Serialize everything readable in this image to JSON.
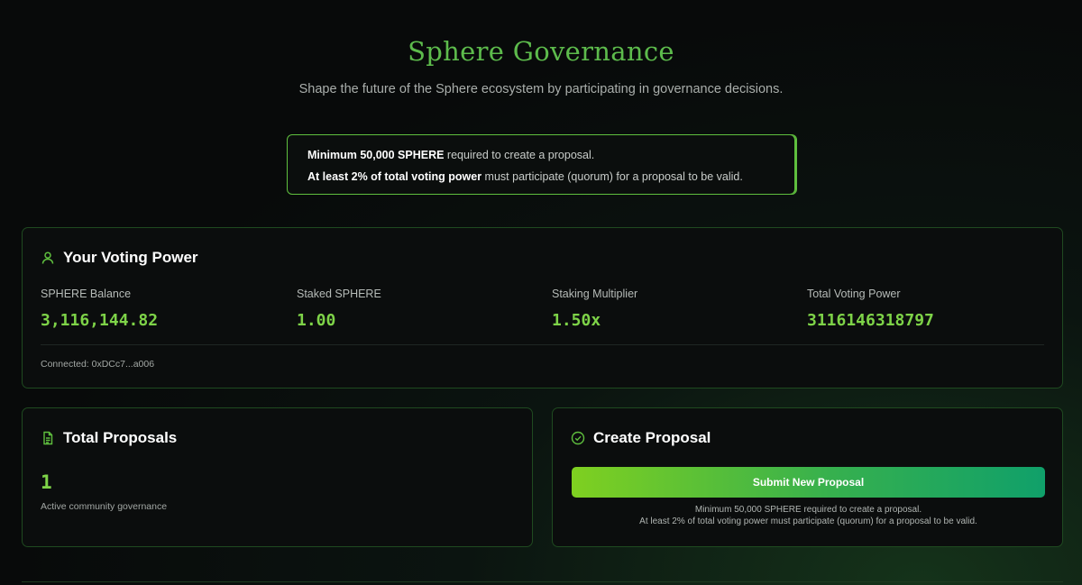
{
  "header": {
    "title": "Sphere Governance",
    "subtitle": "Shape the future of the Sphere ecosystem by participating in governance decisions."
  },
  "notice": {
    "line1_bold": "Minimum 50,000 SPHERE",
    "line1_rest": " required to create a proposal.",
    "line2_bold": "At least 2% of total voting power",
    "line2_rest": " must participate (quorum) for a proposal to be valid."
  },
  "voting_power": {
    "title": "Your Voting Power",
    "icon": "user-icon",
    "stats": [
      {
        "label": "SPHERE Balance",
        "value": "3,116,144.82"
      },
      {
        "label": "Staked SPHERE",
        "value": "1.00"
      },
      {
        "label": "Staking Multiplier",
        "value": "1.50x"
      },
      {
        "label": "Total Voting Power",
        "value": "3116146318797"
      }
    ],
    "connected": "Connected: 0xDCc7...a006"
  },
  "total_proposals": {
    "title": "Total Proposals",
    "icon": "document-icon",
    "count": "1",
    "subtitle": "Active community governance"
  },
  "create_proposal": {
    "title": "Create Proposal",
    "icon": "check-circle-icon",
    "button_label": "Submit New Proposal",
    "note1": "Minimum 50,000 SPHERE required to create a proposal.",
    "note2": "At least 2% of total voting power must participate (quorum) for a proposal to be valid."
  },
  "colors": {
    "accent": "#5dbb4c",
    "value_green": "#7ed348",
    "border_green": "#1f4a20"
  }
}
